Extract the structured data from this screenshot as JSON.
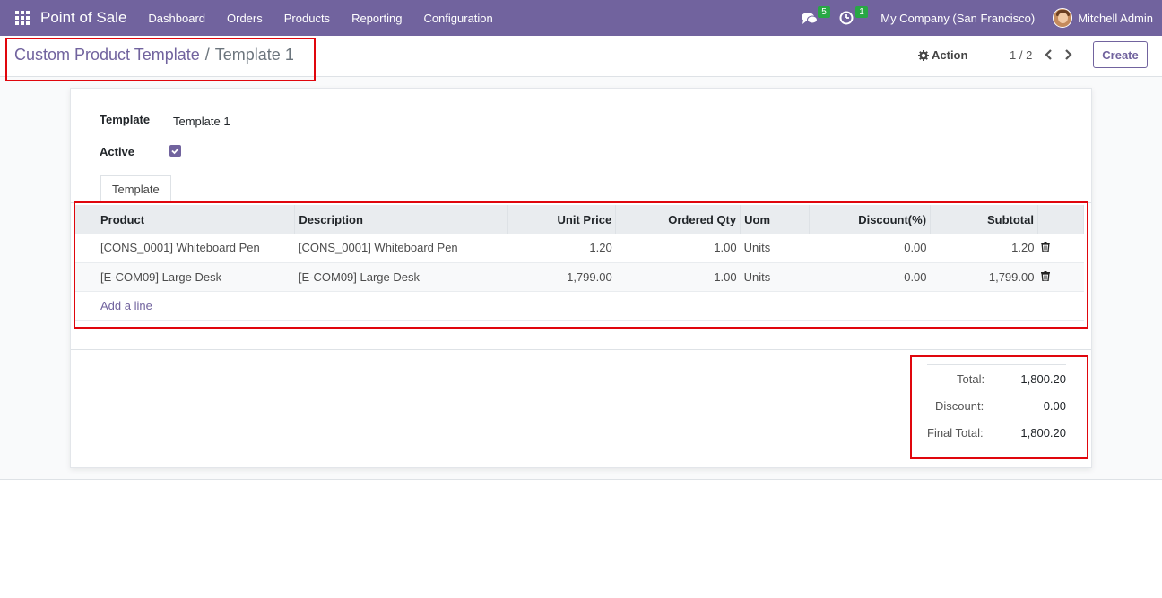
{
  "navbar": {
    "app_name": "Point of Sale",
    "menu": [
      "Dashboard",
      "Orders",
      "Products",
      "Reporting",
      "Configuration"
    ],
    "messages_count": "5",
    "activities_count": "1",
    "company": "My Company (San Francisco)",
    "user": "Mitchell Admin",
    "color": "#71639e"
  },
  "control_panel": {
    "breadcrumb_parent": "Custom Product Template",
    "breadcrumb_separator": "/",
    "breadcrumb_current": "Template 1",
    "action_label": "Action",
    "pager": "1 / 2",
    "create_label": "Create"
  },
  "form": {
    "template_label": "Template",
    "template_value": "Template 1",
    "active_label": "Active",
    "active_checked": true,
    "tab_label": "Template"
  },
  "table": {
    "headers": {
      "product": "Product",
      "description": "Description",
      "unit_price": "Unit Price",
      "ordered_qty": "Ordered Qty",
      "uom": "Uom",
      "discount": "Discount(%)",
      "subtotal": "Subtotal"
    },
    "rows": [
      {
        "product": "[CONS_0001] Whiteboard Pen",
        "description": "[CONS_0001] Whiteboard Pen",
        "unit_price": "1.20",
        "ordered_qty": "1.00",
        "uom": "Units",
        "discount": "0.00",
        "subtotal": "1.20"
      },
      {
        "product": "[E-COM09] Large Desk",
        "description": "[E-COM09] Large Desk",
        "unit_price": "1,799.00",
        "ordered_qty": "1.00",
        "uom": "Units",
        "discount": "0.00",
        "subtotal": "1,799.00"
      }
    ],
    "add_line": "Add a line"
  },
  "totals": {
    "total_label": "Total:",
    "total_value": "1,800.20",
    "discount_label": "Discount:",
    "discount_value": "0.00",
    "final_label": "Final Total:",
    "final_value": "1,800.20"
  }
}
